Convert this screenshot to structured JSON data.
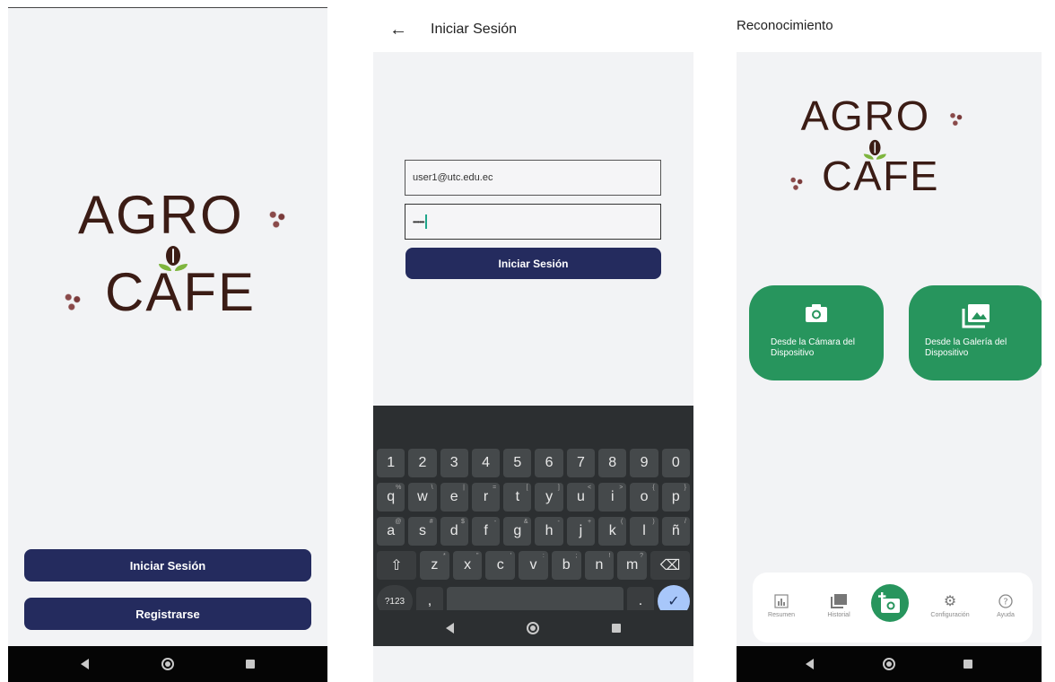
{
  "screen1": {
    "logo_top": "AGRO",
    "logo_bottom": "CAFE",
    "login_button": "Iniciar Sesión",
    "register_button": "Registrarse"
  },
  "screen2": {
    "title": "Iniciar Sesión",
    "email_value": "user1@utc.edu.ec",
    "password_value": "•••••••",
    "submit_button": "Iniciar Sesión",
    "keyboard": {
      "row1": [
        "1",
        "2",
        "3",
        "4",
        "5",
        "6",
        "7",
        "8",
        "9",
        "0"
      ],
      "row2": [
        [
          "q",
          "%"
        ],
        [
          "w",
          "\\"
        ],
        [
          "e",
          "|"
        ],
        [
          "r",
          "="
        ],
        [
          "t",
          "["
        ],
        [
          "y",
          "]"
        ],
        [
          "u",
          "<"
        ],
        [
          "i",
          ">"
        ],
        [
          "o",
          "{"
        ],
        [
          "p",
          "}"
        ]
      ],
      "row3": [
        [
          "a",
          "@"
        ],
        [
          "s",
          "#"
        ],
        [
          "d",
          "$"
        ],
        [
          "f",
          "-"
        ],
        [
          "g",
          "&"
        ],
        [
          "h",
          "-"
        ],
        [
          "j",
          "+"
        ],
        [
          "k",
          "("
        ],
        [
          "l",
          ")"
        ],
        [
          "ñ",
          "/"
        ]
      ],
      "row4": [
        [
          "z",
          "*"
        ],
        [
          "x",
          "\""
        ],
        [
          "c",
          "'"
        ],
        [
          "v",
          ":"
        ],
        [
          "b",
          ";"
        ],
        [
          "n",
          "!"
        ],
        [
          "m",
          "?"
        ]
      ],
      "symbols_key": "?123",
      "comma_key": ",",
      "period_key": "."
    }
  },
  "screen3": {
    "title": "Reconocimiento",
    "logo_top": "AGRO",
    "logo_bottom": "CAFE",
    "camera_button": "Desde la Cámara del Dispositivo",
    "gallery_button": "Desde la Galería del Dispositivo",
    "bottom_nav": {
      "summary": "Resumen",
      "history": "Historial",
      "settings": "Configuración",
      "help": "Ayuda"
    }
  },
  "colors": {
    "navy": "#242b5e",
    "green": "#27955d",
    "brown": "#3b1c15"
  }
}
